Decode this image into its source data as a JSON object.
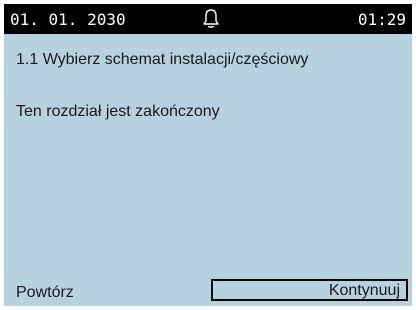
{
  "status_bar": {
    "date": "01. 01. 2030",
    "time": "01:29",
    "icon": "bell-icon"
  },
  "screen": {
    "title": "1.1 Wybierz schemat instalacji/częściowy",
    "message": "Ten rozdział jest zakończony"
  },
  "buttons": {
    "repeat_label": "Powtórz",
    "continue_label": "Kontynuuj"
  },
  "colors": {
    "panel_background": "#b6d2de",
    "status_bar_background": "#000000",
    "status_bar_text": "#ffffff"
  }
}
